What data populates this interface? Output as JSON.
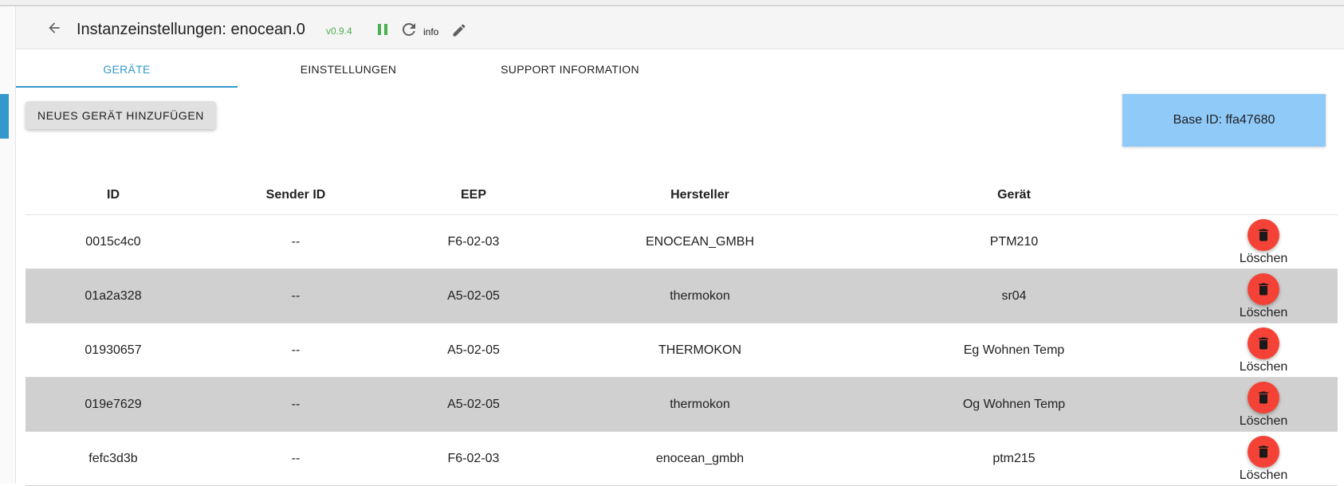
{
  "header": {
    "title": "Instanzeinstellungen:  enocean.0",
    "version": "v0.9.4",
    "info_label": "info"
  },
  "tabs": [
    {
      "label": "GERÄTE",
      "active": true
    },
    {
      "label": "EINSTELLUNGEN",
      "active": false
    },
    {
      "label": "SUPPORT INFORMATION",
      "active": false
    }
  ],
  "actions": {
    "add_device_label": "NEUES GERÄT HINZUFÜGEN",
    "base_id_label": "Base ID: ffa47680"
  },
  "table": {
    "columns": [
      "ID",
      "Sender ID",
      "EEP",
      "Hersteller",
      "Gerät"
    ],
    "delete_label": "Löschen",
    "rows": [
      {
        "id": "0015c4c0",
        "sender_id": "--",
        "eep": "F6-02-03",
        "manufacturer": "ENOCEAN_GMBH",
        "device": "PTM210"
      },
      {
        "id": "01a2a328",
        "sender_id": "--",
        "eep": "A5-02-05",
        "manufacturer": "thermokon",
        "device": "sr04"
      },
      {
        "id": "01930657",
        "sender_id": "--",
        "eep": "A5-02-05",
        "manufacturer": "THERMOKON",
        "device": "Eg Wohnen Temp"
      },
      {
        "id": "019e7629",
        "sender_id": "--",
        "eep": "A5-02-05",
        "manufacturer": "thermokon",
        "device": "Og Wohnen Temp"
      },
      {
        "id": "fefc3d3b",
        "sender_id": "--",
        "eep": "F6-02-03",
        "manufacturer": "enocean_gmbh",
        "device": "ptm215"
      }
    ]
  },
  "colors": {
    "accent": "#3399cc",
    "version_green": "#4caf50",
    "delete_red": "#f44336",
    "base_id_bg": "#90caf9",
    "row_shade": "#d0d0d0"
  },
  "icons": {
    "back": "arrow-left-icon",
    "pause": "pause-icon",
    "reload": "refresh-icon",
    "edit": "pencil-icon",
    "delete": "trash-icon"
  }
}
